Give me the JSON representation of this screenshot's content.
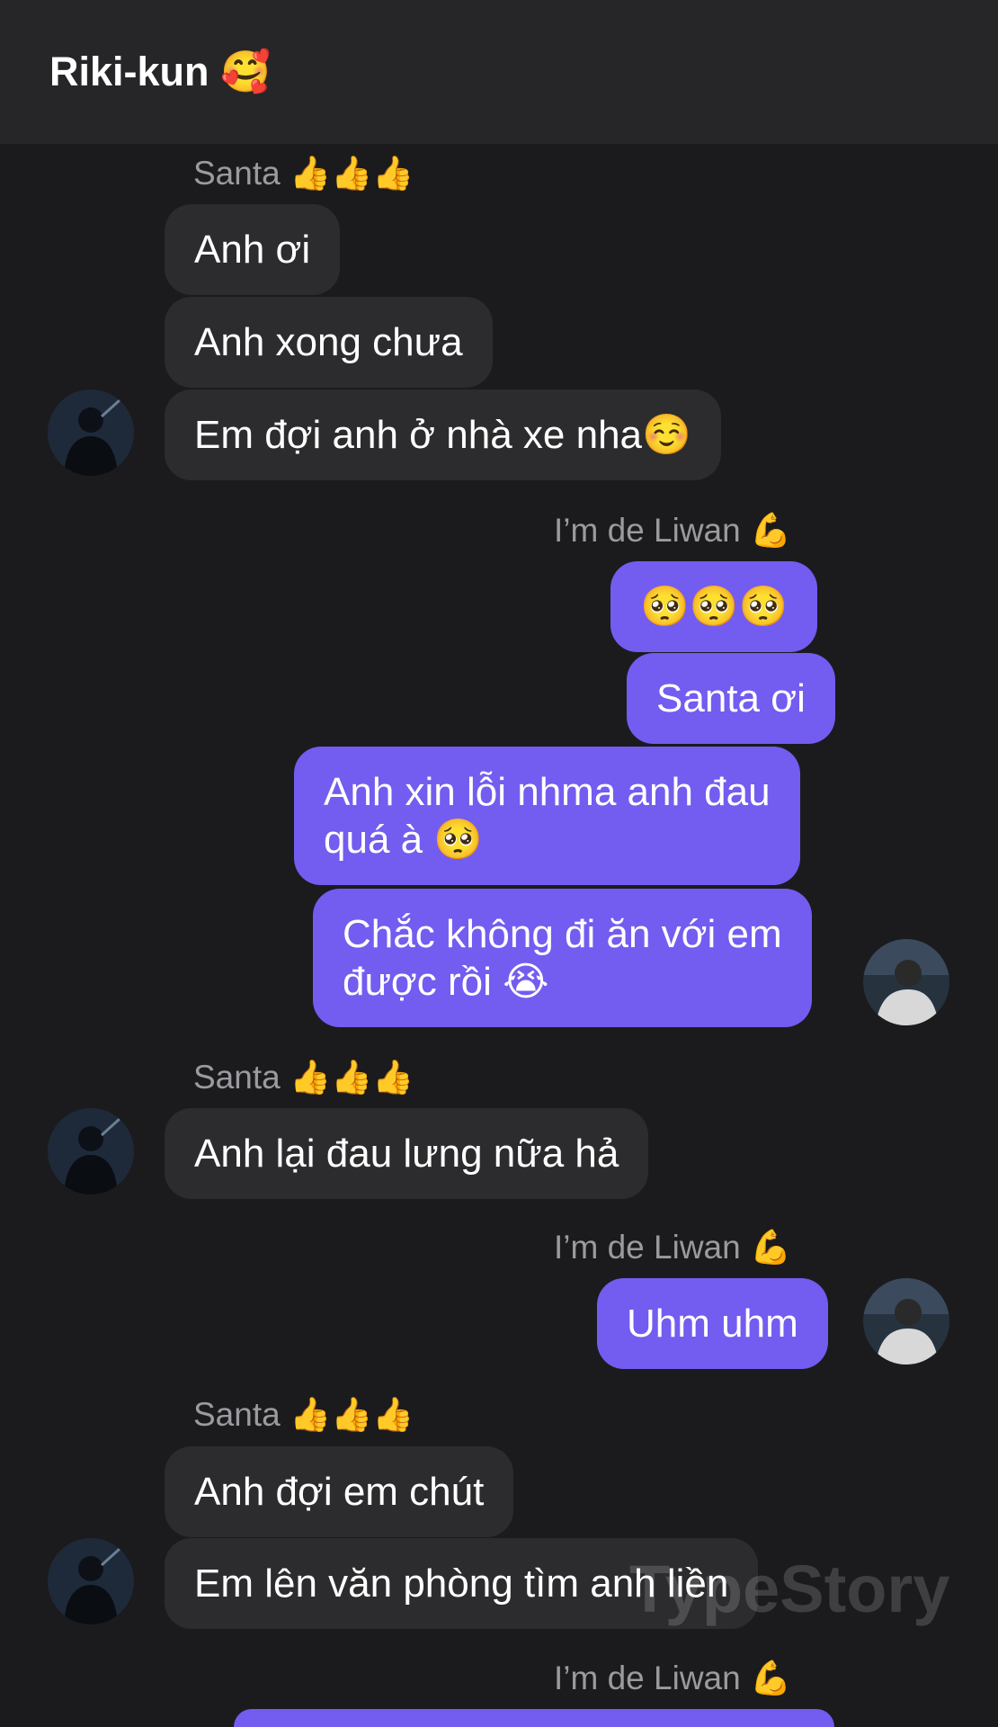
{
  "header": {
    "title": "Riki-kun 🥰"
  },
  "messages": {
    "g1": {
      "sender": "Santa 👍👍👍",
      "m1": "Anh ơi",
      "m2": "Anh xong chưa",
      "m3": "Em đợi anh ở nhà xe nha☺️"
    },
    "g2": {
      "sender": "I’m de Liwan 💪",
      "m1": "🥺🥺🥺",
      "m2": "Santa ơi",
      "m3": "Anh xin lỗi nhma anh đau",
      "m3b": "quá à 🥺",
      "m4": "Chắc không đi ăn với em",
      "m4b": "được rồi 😭"
    },
    "g3": {
      "sender": "Santa 👍👍👍",
      "m1": "Anh lại đau lưng nữa hả"
    },
    "g4": {
      "sender": "I’m de Liwan 💪",
      "m1": "Uhm uhm"
    },
    "g5": {
      "sender": "Santa 👍👍👍",
      "m1": "Anh đợi em chút",
      "m2": "Em lên văn phòng tìm anh liền"
    },
    "g6": {
      "sender": "I’m de Liwan 💪"
    }
  },
  "watermark": "TypeStory",
  "colors": {
    "background": "#1b1b1d",
    "header": "#262628",
    "incoming_bubble": "#2c2c2e",
    "outgoing_bubble": "#735cf0",
    "sender_name": "#9a9a9f"
  }
}
